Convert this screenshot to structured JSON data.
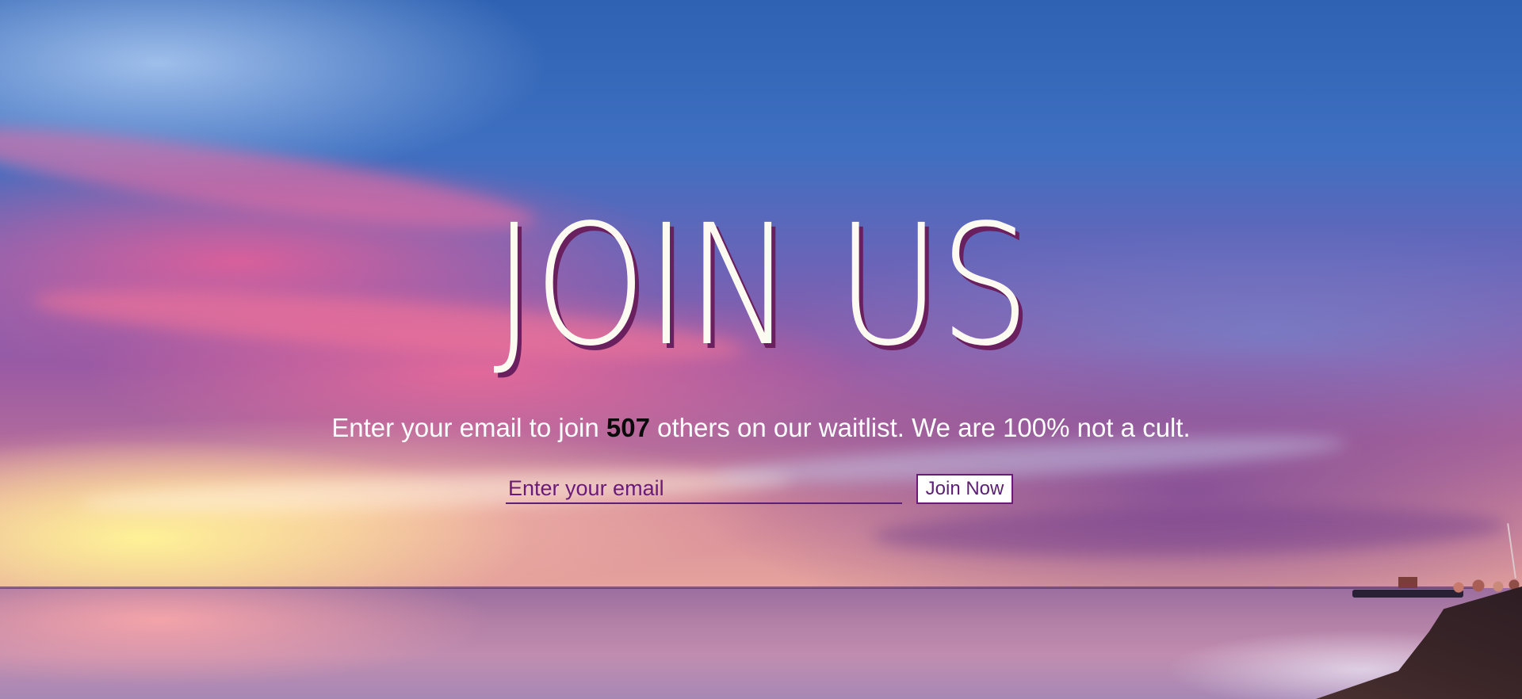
{
  "hero": {
    "heading": "JOIN US",
    "tagline_before": "Enter your email to join ",
    "waitlist_count": "507",
    "tagline_after": " others on our waitlist. We are 100% not a cult."
  },
  "signup": {
    "email_placeholder": "Enter your email",
    "button_label": "Join Now"
  },
  "colors": {
    "heading_text": "#fdfbf1",
    "heading_shadow": "#6a1f5e",
    "accent_purple": "#6b1a7a"
  },
  "background": {
    "scene": "sunset-sky-over-sea"
  }
}
